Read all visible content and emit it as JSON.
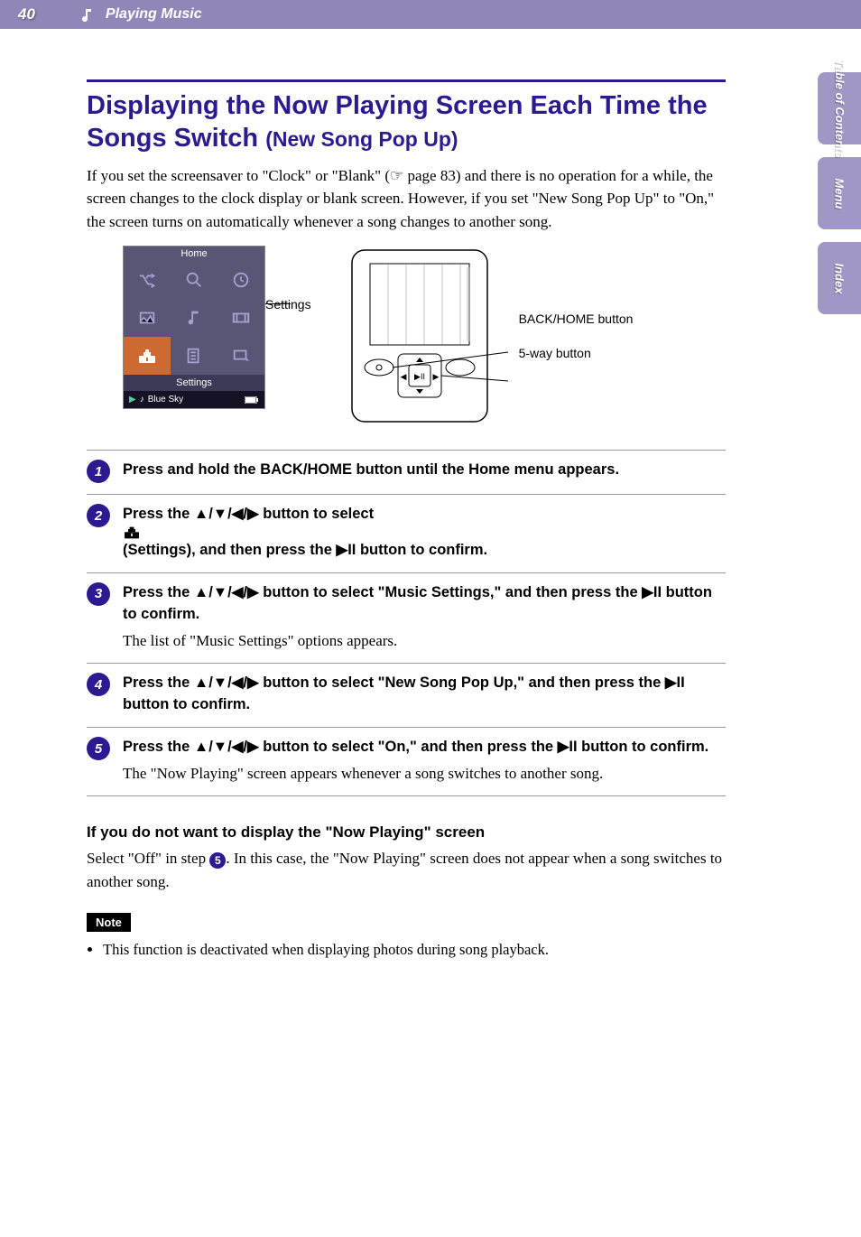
{
  "header": {
    "page_number": "40",
    "section": "Playing Music"
  },
  "side_tabs": {
    "toc": "Table of\nContents",
    "menu": "Menu",
    "index": "Index"
  },
  "title": {
    "main": "Displaying the Now Playing Screen Each Time the Songs Switch ",
    "sub": "(New Song Pop Up)"
  },
  "intro": "If you set the screensaver to \"Clock\" or \"Blank\" (☞ page 83) and there is no operation for a while, the screen changes to the clock display or blank screen. However, if you set \"New Song Pop Up\" to \"On,\" the screen turns on automatically whenever a song changes to another song.",
  "diagram": {
    "screen_top": "Home",
    "screen_settings_label": "Settings",
    "now_playing_song": "Blue Sky",
    "callout_settings": "Settings",
    "callout_back_home": "BACK/HOME button",
    "callout_5way": "5-way button"
  },
  "steps": [
    {
      "num": "1",
      "head": "Press and hold the BACK/HOME button until the Home menu appears.",
      "desc": ""
    },
    {
      "num": "2",
      "head_prefix": "Press the ",
      "head_arrows": "▲/▼/◀/▶",
      "head_middle": " button to select ",
      "head_icon": "settings",
      "head_suffix": " (Settings), and then press the ",
      "head_play": "▶II",
      "head_end": " button to confirm.",
      "desc": ""
    },
    {
      "num": "3",
      "head_prefix": "Press the ",
      "head_arrows": "▲/▼/◀/▶",
      "head_middle": " button to select \"Music Settings,\" and then press the ",
      "head_play": "▶II",
      "head_end": " button to confirm.",
      "desc": "The list of \"Music Settings\" options appears."
    },
    {
      "num": "4",
      "head_prefix": "Press the ",
      "head_arrows": "▲/▼/◀/▶",
      "head_middle": " button to select \"New Song Pop Up,\" and then press the ",
      "head_play": "▶II",
      "head_end": " button to confirm.",
      "desc": ""
    },
    {
      "num": "5",
      "head_prefix": "Press the ",
      "head_arrows": "▲/▼/◀/▶",
      "head_middle": " button to select \"On,\" and then press the ",
      "head_play": "▶II",
      "head_end": " button to confirm.",
      "desc": "The \"Now Playing\" screen appears whenever a song switches to another song."
    }
  ],
  "alt_section": {
    "heading": "If you do not want to display the \"Now Playing\" screen",
    "body_pre": "Select \"Off\" in step ",
    "body_step": "5",
    "body_post": ". In this case, the \"Now Playing\" screen does not appear when a song switches to another song."
  },
  "note_label": "Note",
  "notes": [
    "This function is deactivated when displaying photos during song playback."
  ]
}
